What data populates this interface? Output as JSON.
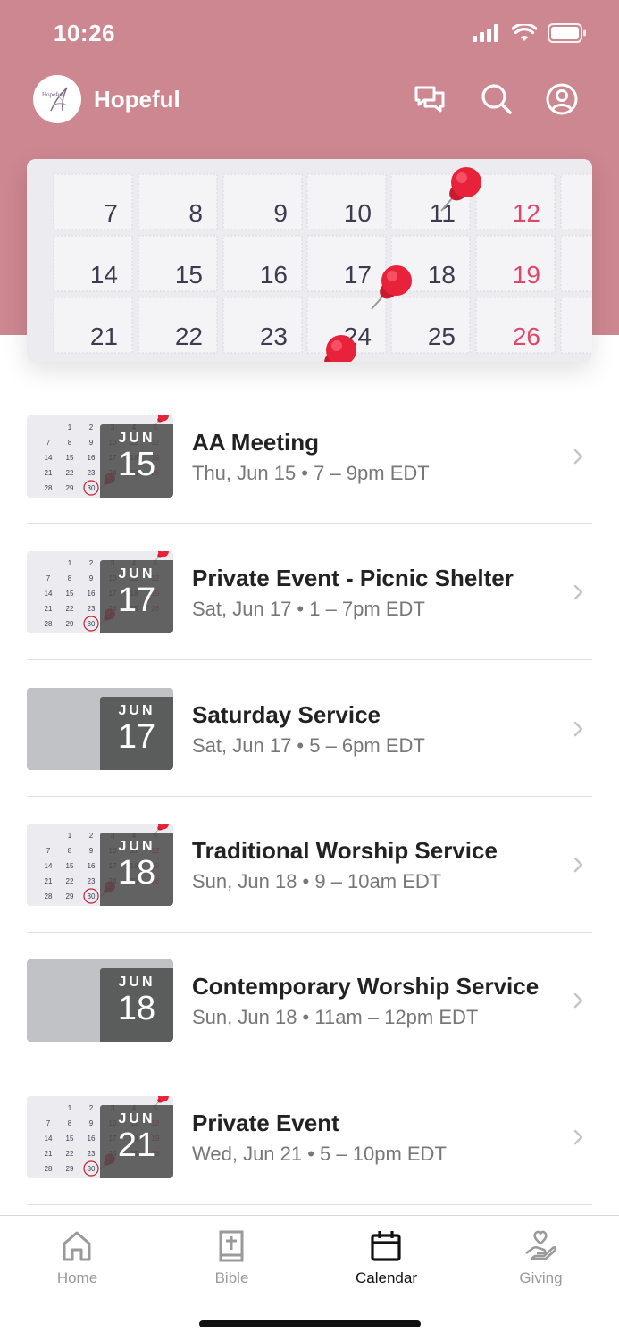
{
  "status_bar": {
    "time": "10:26"
  },
  "header": {
    "app_title": "Hopeful",
    "logo_text": "Hopeful"
  },
  "hero": {
    "calendar_rows": [
      [
        "7",
        "8",
        "9",
        "10",
        "11",
        "12"
      ],
      [
        "14",
        "15",
        "16",
        "17",
        "18",
        "19"
      ],
      [
        "21",
        "22",
        "23",
        "24",
        "25",
        "26"
      ]
    ]
  },
  "thumb_calendar": [
    "1",
    "2",
    "3",
    "4",
    "5",
    "7",
    "8",
    "9",
    "10",
    "11",
    "12",
    "14",
    "15",
    "16",
    "17",
    "18",
    "19",
    "21",
    "22",
    "23",
    "24",
    "25",
    "26",
    "28",
    "29",
    "30"
  ],
  "events": [
    {
      "month": "JUN",
      "day": "15",
      "title": "AA Meeting",
      "subtitle": "Thu, Jun 15 • 7 – 9pm EDT",
      "thumb": "photo"
    },
    {
      "month": "JUN",
      "day": "17",
      "title": "Private Event - Picnic Shelter",
      "subtitle": "Sat, Jun 17 • 1 – 7pm EDT",
      "thumb": "photo"
    },
    {
      "month": "JUN",
      "day": "17",
      "title": "Saturday Service",
      "subtitle": "Sat, Jun 17 • 5 – 6pm EDT",
      "thumb": "plain"
    },
    {
      "month": "JUN",
      "day": "18",
      "title": "Traditional Worship Service",
      "subtitle": "Sun, Jun 18 • 9 – 10am EDT",
      "thumb": "photo"
    },
    {
      "month": "JUN",
      "day": "18",
      "title": "Contemporary Worship Service",
      "subtitle": "Sun, Jun 18 • 11am – 12pm EDT",
      "thumb": "plain"
    },
    {
      "month": "JUN",
      "day": "21",
      "title": "Private Event",
      "subtitle": "Wed, Jun 21 • 5 – 10pm EDT",
      "thumb": "photo"
    }
  ],
  "tabs": [
    {
      "label": "Home",
      "icon": "home-icon",
      "active": false
    },
    {
      "label": "Bible",
      "icon": "bible-icon",
      "active": false
    },
    {
      "label": "Calendar",
      "icon": "calendar-icon",
      "active": true
    },
    {
      "label": "Giving",
      "icon": "giving-icon",
      "active": false
    }
  ],
  "colors": {
    "header": "#cd8791",
    "pin": "#e8223a",
    "weekend": "#e0456a",
    "badge": "#4b4b4b"
  }
}
